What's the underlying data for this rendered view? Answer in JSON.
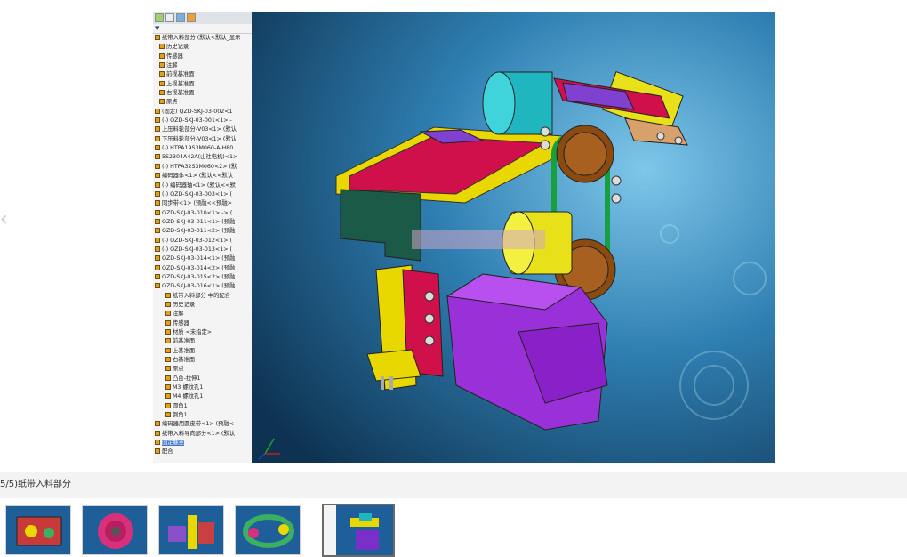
{
  "viewer": {
    "caption": "5/5)纸带入料部分",
    "tree_items": [
      "纸带入料部分 (默认<默认_显示",
      "历史记录",
      "传感器",
      "注解",
      "前视基准面",
      "上视基准面",
      "右视基准面",
      "原点",
      "(固定) QZD-SKJ-03-002<1",
      "(-) QZD-SKJ-03-001<1> -",
      "上压料轮部分-V03<1> (默认",
      "下压料轮部分-V03<1> (默认",
      "(-) HTPA19S3M060-A-H80",
      "5S2304A42A(山社电机)<1>",
      "(-) HTPA32S3M060<2> (默",
      "编码器体<1> (默认<<默认",
      "(-) 编码器轴<1> (默认<<默",
      "(-) QZD-SKJ-03-003<1> (",
      "同步带<1> (预融<<预融>_",
      "QZD-SKJ-03-010<1> -> (",
      "QZD-SKJ-03-011<1> (预融",
      "QZD-SKJ-03-011<2> (预融",
      "(-) QZD-SKJ-03-012<1> (",
      "(-) QZD-SKJ-03-013<1> (",
      "QZD-SKJ-03-014<1> (预融",
      "QZD-SKJ-03-014<2> (预融",
      "QZD-SKJ-03-015<2> (预融",
      "QZD-SKJ-03-016<1> (预融",
      "纸带入料部分 中的配合",
      "历史记录",
      "注解",
      "传感器",
      "材质 <未指定>",
      "前基准面",
      "上基准面",
      "右基准面",
      "原点",
      "凸台-拉伸1",
      "M3 螺纹孔1",
      "M4 螺纹孔1",
      "圆角1",
      "倒角1",
      "编码器用圆皮带<1> (预融<",
      "纸带入料导向部分<1> (默认",
      "固定螺丝",
      "配合"
    ],
    "selected_tree_index": 44
  },
  "thumbnails": [
    {
      "name": "thumb-1",
      "accent": "#c83a3a"
    },
    {
      "name": "thumb-2",
      "accent": "#d8307a"
    },
    {
      "name": "thumb-3",
      "accent": "#8a50c8"
    },
    {
      "name": "thumb-4",
      "accent": "#3ab060"
    },
    {
      "name": "thumb-5",
      "accent": "#7a30c8",
      "active": true
    }
  ]
}
